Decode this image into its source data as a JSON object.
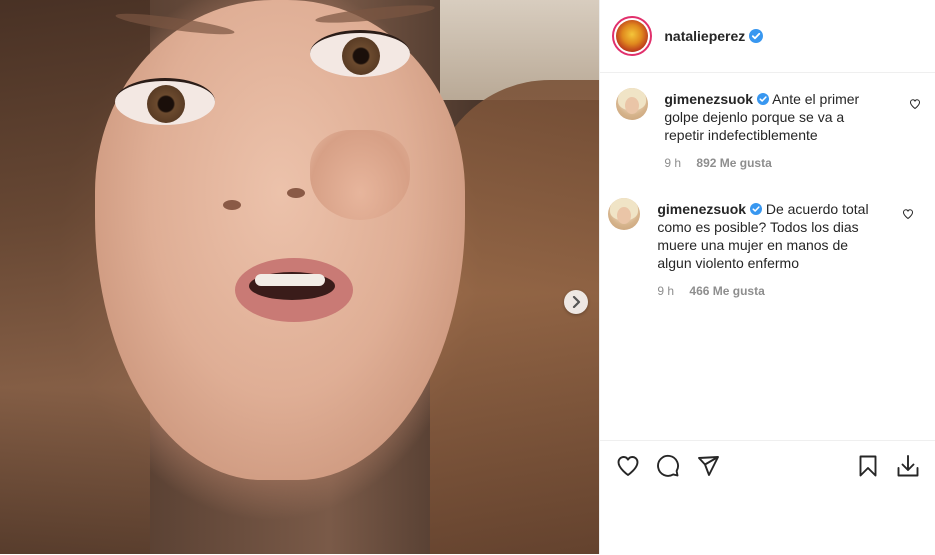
{
  "post": {
    "author": "natalieperez",
    "verified": true
  },
  "comments": [
    {
      "username": "gimenezsuok",
      "verified": true,
      "text_lines": [
        "Ante el primer",
        "golpe dejenlo porque se va a",
        "repetir indefectiblemente"
      ],
      "time": "9 h",
      "likes": "892 Me gusta"
    },
    {
      "username": "gimenezsuok",
      "verified": true,
      "text_lines": [
        "De acuerdo total",
        "como es posible? Todos los dias",
        "muere una mujer en manos de",
        "algun violento enfermo"
      ],
      "time": "9 h",
      "likes": "466 Me gusta"
    }
  ],
  "icons": {
    "like": "heart-icon",
    "comment": "comment-icon",
    "share": "share-icon",
    "save": "bookmark-icon",
    "download": "download-icon",
    "next": "chevron-right-icon"
  },
  "colors": {
    "verified_blue": "#3897f0",
    "text": "#262626",
    "muted": "#8e8e8e",
    "story_ring": "#e1306c"
  }
}
